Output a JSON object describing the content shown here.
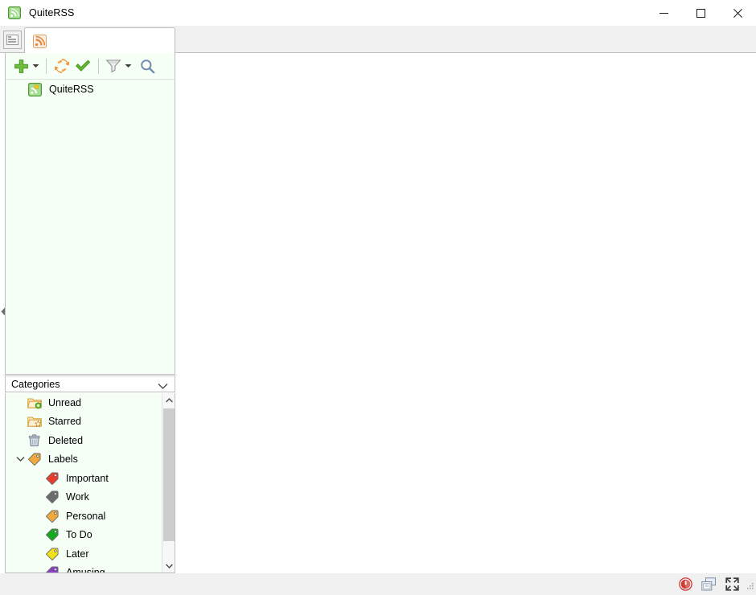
{
  "window": {
    "title": "QuiteRSS",
    "icon": "rss-icon",
    "controls": {
      "minimize": "minimize-button",
      "maximize": "maximize-button",
      "close": "close-button"
    }
  },
  "tabbar": {
    "list_button": "tab-list-button",
    "tabs": [
      {
        "label": "",
        "icon": "rss-icon",
        "active": true
      }
    ]
  },
  "feed_toolbar": {
    "buttons": [
      {
        "name": "add-feed-button",
        "icon": "plus-icon",
        "has_menu": true
      },
      {
        "name": "update-feed-button",
        "icon": "refresh-icon",
        "has_menu": false
      },
      {
        "name": "mark-read-button",
        "icon": "checkmark-icon",
        "has_menu": false
      },
      {
        "name": "filter-feeds-button",
        "icon": "funnel-icon",
        "has_menu": true
      },
      {
        "name": "search-feed-button",
        "icon": "magnifier-icon",
        "has_menu": false
      }
    ]
  },
  "feed_tree": {
    "items": [
      {
        "label": "QuiteRSS",
        "icon": "rss-feed-icon"
      }
    ]
  },
  "categories": {
    "header": "Categories",
    "header_icon": "chevron-down-icon",
    "items": [
      {
        "label": "Unread",
        "icon": "folder-unread-icon",
        "depth": 0,
        "twisty": "",
        "color": "#e8a33d"
      },
      {
        "label": "Starred",
        "icon": "folder-starred-icon",
        "depth": 0,
        "twisty": "",
        "color": "#e8a33d"
      },
      {
        "label": "Deleted",
        "icon": "trash-icon",
        "depth": 0,
        "twisty": "",
        "color": "#8a9aa8"
      },
      {
        "label": "Labels",
        "icon": "tag-icon",
        "depth": 0,
        "twisty": "expanded",
        "color": "#f0a93c"
      },
      {
        "label": "Important",
        "icon": "tag-icon",
        "depth": 1,
        "twisty": "",
        "color": "#e83c2e"
      },
      {
        "label": "Work",
        "icon": "tag-icon",
        "depth": 1,
        "twisty": "",
        "color": "#6b6b6b"
      },
      {
        "label": "Personal",
        "icon": "tag-icon",
        "depth": 1,
        "twisty": "",
        "color": "#f0a93c"
      },
      {
        "label": "To Do",
        "icon": "tag-icon",
        "depth": 1,
        "twisty": "",
        "color": "#16a81e"
      },
      {
        "label": "Later",
        "icon": "tag-icon",
        "depth": 1,
        "twisty": "",
        "color": "#f2e118"
      },
      {
        "label": "Amusing",
        "icon": "tag-icon",
        "depth": 1,
        "twisty": "",
        "color": "#8d3fc4"
      }
    ],
    "scrollbar": {
      "up": "scroll-up-button",
      "down": "scroll-down-button",
      "thumb": "scroll-thumb"
    }
  },
  "statusbar": {
    "items": [
      {
        "name": "stop-loading-icon"
      },
      {
        "name": "layout-toggle-icon"
      },
      {
        "name": "fullscreen-icon"
      }
    ]
  },
  "colors": {
    "panel_bg": "#f5fff5",
    "chrome_bg": "#f0f0f0",
    "border": "#bfbfbf",
    "content_bg": "#ffffff"
  }
}
